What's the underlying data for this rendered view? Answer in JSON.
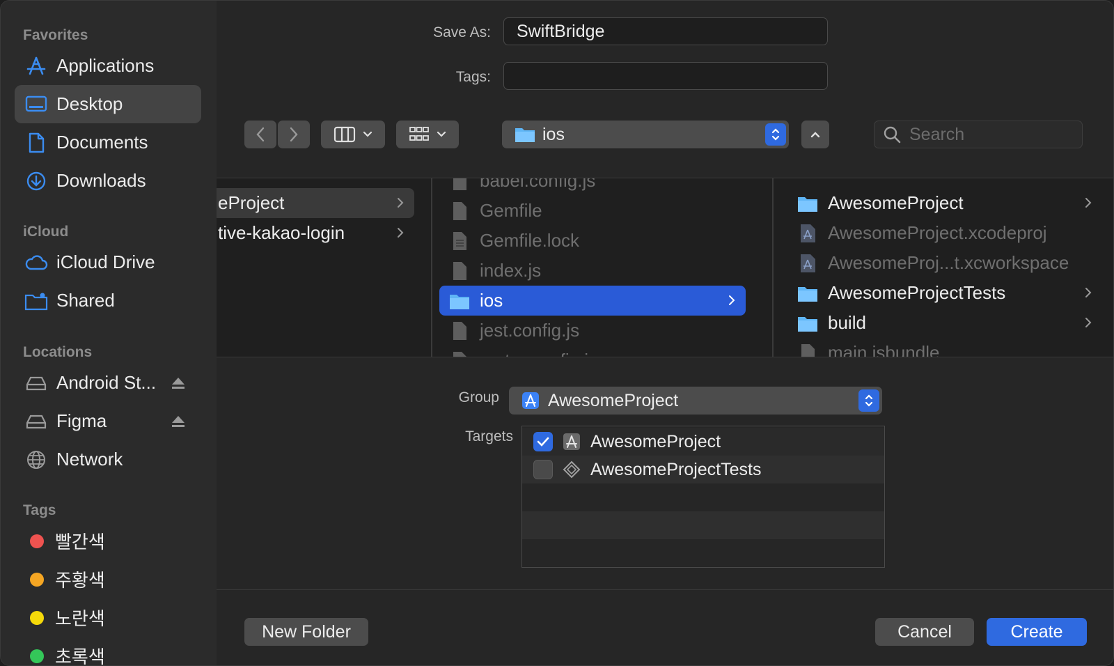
{
  "sidebar": {
    "favorites_label": "Favorites",
    "icloud_label": "iCloud",
    "locations_label": "Locations",
    "tags_label": "Tags",
    "favorites": [
      {
        "label": "Applications",
        "icon": "applications-icon"
      },
      {
        "label": "Desktop",
        "icon": "desktop-icon",
        "selected": true
      },
      {
        "label": "Documents",
        "icon": "document-icon"
      },
      {
        "label": "Downloads",
        "icon": "downloads-icon"
      }
    ],
    "icloud": [
      {
        "label": "iCloud Drive",
        "icon": "cloud-icon"
      },
      {
        "label": "Shared",
        "icon": "shared-folder-icon"
      }
    ],
    "locations": [
      {
        "label": "Android St...",
        "icon": "drive-icon"
      },
      {
        "label": "Figma",
        "icon": "drive-icon"
      },
      {
        "label": "Network",
        "icon": "globe-icon"
      }
    ],
    "tags": [
      {
        "label": "빨간색",
        "color": "#ef5350"
      },
      {
        "label": "주황색",
        "color": "#f5a623"
      },
      {
        "label": "노란색",
        "color": "#f5d90a"
      },
      {
        "label": "초록색",
        "color": "#34c759"
      }
    ]
  },
  "form": {
    "save_as_label": "Save As:",
    "save_as_value": "SwiftBridge",
    "tags_label": "Tags:",
    "tags_value": ""
  },
  "toolbar": {
    "location": "ios",
    "search_placeholder": "Search"
  },
  "browser": {
    "col1": [
      {
        "label": "eProject",
        "folder": true,
        "highlighted": true
      },
      {
        "label": "tive-kakao-login",
        "folder": true
      }
    ],
    "col2": [
      {
        "label": "babel.config.js",
        "dim": true
      },
      {
        "label": "Gemfile",
        "dim": true
      },
      {
        "label": "Gemfile.lock",
        "dim": true
      },
      {
        "label": "index.js",
        "dim": true
      },
      {
        "label": "ios",
        "folder": true,
        "selected": true
      },
      {
        "label": "jest.config.js",
        "dim": true
      },
      {
        "label": "metro.config.js",
        "dim": true
      }
    ],
    "col3": [
      {
        "label": "AwesomeProject",
        "folder": true
      },
      {
        "label": "AwesomeProject.xcodeproj",
        "dim": true
      },
      {
        "label": "AwesomeProj...t.xcworkspace",
        "dim": true
      },
      {
        "label": "AwesomeProjectTests",
        "folder": true
      },
      {
        "label": "build",
        "folder": true
      },
      {
        "label": "main.jsbundle",
        "dim": true
      }
    ]
  },
  "options": {
    "group_label": "Group",
    "group_value": "AwesomeProject",
    "targets_label": "Targets",
    "targets": [
      {
        "label": "AwesomeProject",
        "checked": true
      },
      {
        "label": "AwesomeProjectTests",
        "checked": false
      }
    ]
  },
  "buttons": {
    "new_folder": "New Folder",
    "cancel": "Cancel",
    "create": "Create"
  },
  "colors": {
    "accent": "#2f6ae0",
    "selection": "#2a5bd7",
    "folder": "#5fb5f5"
  }
}
